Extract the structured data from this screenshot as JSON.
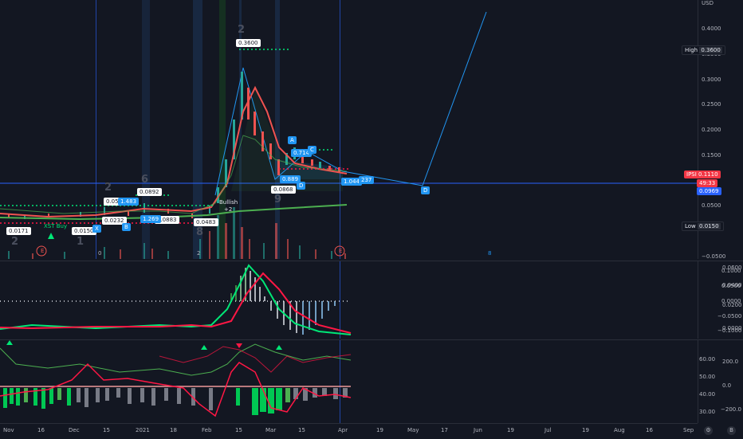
{
  "price_axis": {
    "currency": "USD",
    "ticks": [
      "0.4000",
      "0.3500",
      "0.3000",
      "0.2500",
      "0.2000",
      "0.1500",
      "0.1000",
      "0.0500",
      "0.0000",
      "−0.0500"
    ],
    "high_label": "High",
    "high_value": "0.3600",
    "low_label": "Low",
    "low_value": "0.0150",
    "current_symbol": "IPSI",
    "current_price": "0.1110",
    "countdown": "49:33",
    "secondary_price": "0.0969"
  },
  "macd_axis": {
    "left_ticks": [
      "0.0600",
      "0.0400",
      "0.0200",
      "0.0000"
    ],
    "right_ticks": [
      "0.1000",
      "0.0500",
      "0.0000",
      "−0.0500",
      "−0.1000"
    ]
  },
  "osc_axis": {
    "left_ticks": [
      "60.00",
      "50.00",
      "40.00",
      "30.00"
    ],
    "right_ticks": [
      "200.0",
      "0.0",
      "−200.0"
    ]
  },
  "time_axis": {
    "labels": [
      "Nov",
      "16",
      "Dec",
      "15",
      "2021",
      "18",
      "Feb",
      "15",
      "Mar",
      "15",
      "Apr",
      "19",
      "May",
      "17",
      "Jun",
      "19",
      "Jul",
      "19",
      "Aug",
      "16",
      "Sep"
    ]
  },
  "chart_labels": {
    "top_price": "0.3600",
    "p1": "0.0171",
    "p2": "0.0150",
    "p3": "0.0232",
    "p4": "0.0500",
    "p5": "0.0892",
    "p6": "0.0883",
    "p7": "0.0483",
    "p8": "0.0868",
    "fib1": "1.483",
    "fib2": "1.269",
    "fib3": "0.889",
    "fib4": "0.714",
    "fib5": "1.044",
    "fib6": "237",
    "letters": [
      "X",
      "B",
      "A",
      "C",
      "D",
      "D"
    ],
    "count2": "2",
    "count1": "1",
    "count6": "6",
    "count8": "8",
    "count9": "9",
    "xst_buy": "XST Buy",
    "bullish": "Bullish",
    "plus2": "+2",
    "earnings": "E",
    "n2": "2",
    "n0": "0",
    "n8": "8"
  },
  "colors": {
    "bg": "#131722",
    "up": "#26a69a",
    "down": "#ef5350",
    "blue": "#2196f3",
    "green_line": "#00e676",
    "red_line": "#ff1744"
  },
  "controls": {
    "gear_label": "⚙",
    "auto_label": "B"
  }
}
